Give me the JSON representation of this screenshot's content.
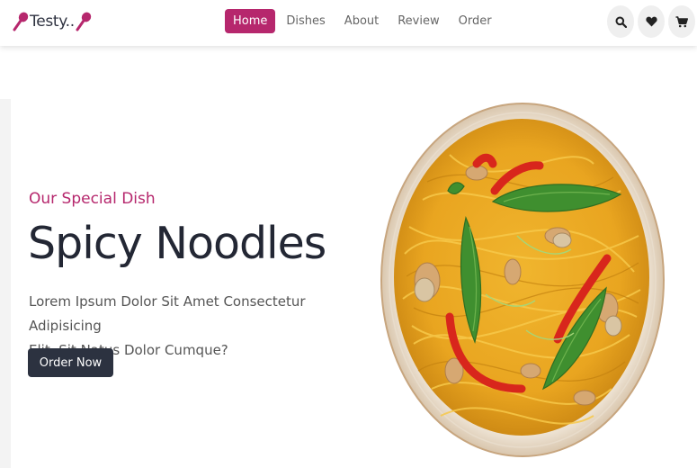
{
  "brand": {
    "name": "Testy..",
    "accent": "#b6276d",
    "dark": "#2c3240"
  },
  "nav": {
    "items": [
      {
        "label": "Home",
        "active": true
      },
      {
        "label": "Dishes",
        "active": false
      },
      {
        "label": "About",
        "active": false
      },
      {
        "label": "Review",
        "active": false
      },
      {
        "label": "Order",
        "active": false
      }
    ]
  },
  "header_icons": [
    "search-icon",
    "heart-icon",
    "cart-icon"
  ],
  "hero": {
    "subtitle": "Our Special Dish",
    "title": "Spicy Noodles",
    "description_line1": "Lorem Ipsum Dolor Sit Amet Consectetur Adipisicing",
    "description_line2": "Elit. Sit Natus Dolor Cumque?",
    "button_label": "Order Now",
    "image": "noodle-dish-image"
  }
}
